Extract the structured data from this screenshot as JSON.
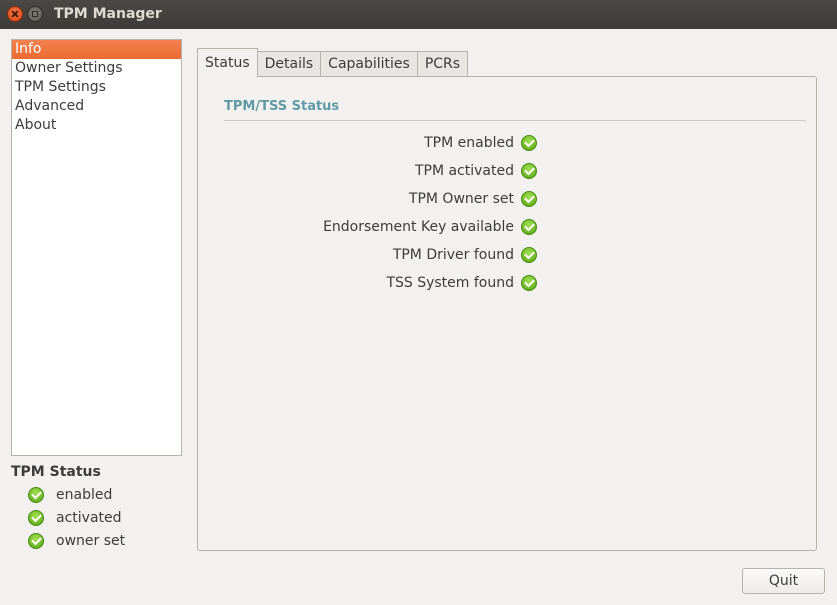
{
  "window": {
    "title": "TPM Manager"
  },
  "sidebar": {
    "items": [
      {
        "label": "Info",
        "selected": true
      },
      {
        "label": "Owner Settings",
        "selected": false
      },
      {
        "label": "TPM Settings",
        "selected": false
      },
      {
        "label": "Advanced",
        "selected": false
      },
      {
        "label": "About",
        "selected": false
      }
    ]
  },
  "tpm_status": {
    "heading": "TPM Status",
    "items": [
      {
        "label": "enabled",
        "icon": "check-circle-icon"
      },
      {
        "label": "activated",
        "icon": "check-circle-icon"
      },
      {
        "label": "owner set",
        "icon": "check-circle-icon"
      }
    ]
  },
  "tabs": [
    {
      "label": "Status",
      "active": true
    },
    {
      "label": "Details",
      "active": false
    },
    {
      "label": "Capabilities",
      "active": false
    },
    {
      "label": "PCRs",
      "active": false
    }
  ],
  "status_group": {
    "title": "TPM/TSS Status",
    "rows": [
      {
        "label": "TPM enabled",
        "icon": "check-circle-icon"
      },
      {
        "label": "TPM activated",
        "icon": "check-circle-icon"
      },
      {
        "label": "TPM Owner set",
        "icon": "check-circle-icon"
      },
      {
        "label": "Endorsement Key available",
        "icon": "check-circle-icon"
      },
      {
        "label": "TPM Driver found",
        "icon": "check-circle-icon"
      },
      {
        "label": "TSS System found",
        "icon": "check-circle-icon"
      }
    ]
  },
  "buttons": {
    "quit_label": "Quit"
  },
  "colors": {
    "accent": "#ec6b32",
    "group_title": "#5f9aa6",
    "check": "#6ab624"
  }
}
